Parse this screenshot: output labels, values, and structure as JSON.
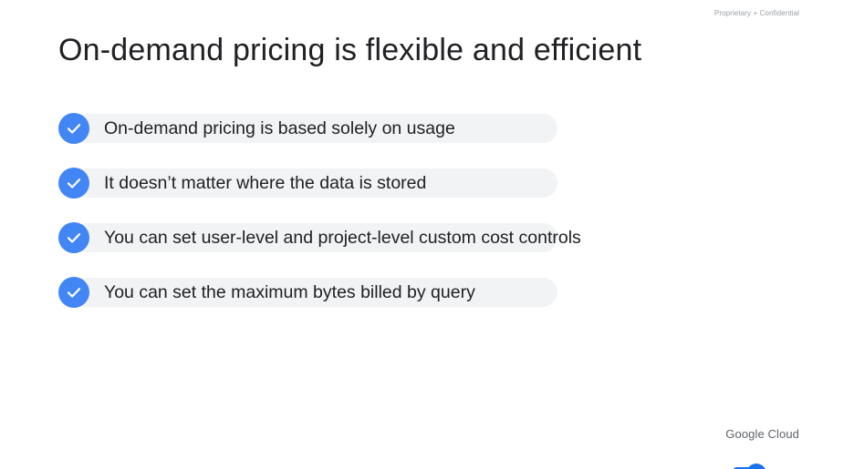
{
  "header": {
    "confidential_label": "Proprietary + Confidential"
  },
  "slide": {
    "title": "On-demand pricing is flexible and efficient",
    "bullets": [
      {
        "text": "On-demand pricing is based solely on usage",
        "icon": "check-circle-icon"
      },
      {
        "text": "It doesn’t matter where the data is stored",
        "icon": "check-circle-icon"
      },
      {
        "text": "You can set user-level and project-level custom cost controls",
        "icon": "check-circle-icon"
      },
      {
        "text": "You can set the maximum bytes billed by query",
        "icon": "check-circle-icon"
      }
    ]
  },
  "footer": {
    "brand": "Google Cloud"
  },
  "colors": {
    "accent": "#4285f4",
    "pill_background": "#f1f3f4",
    "title_text": "#202124",
    "muted_text": "#9aa0a6"
  }
}
